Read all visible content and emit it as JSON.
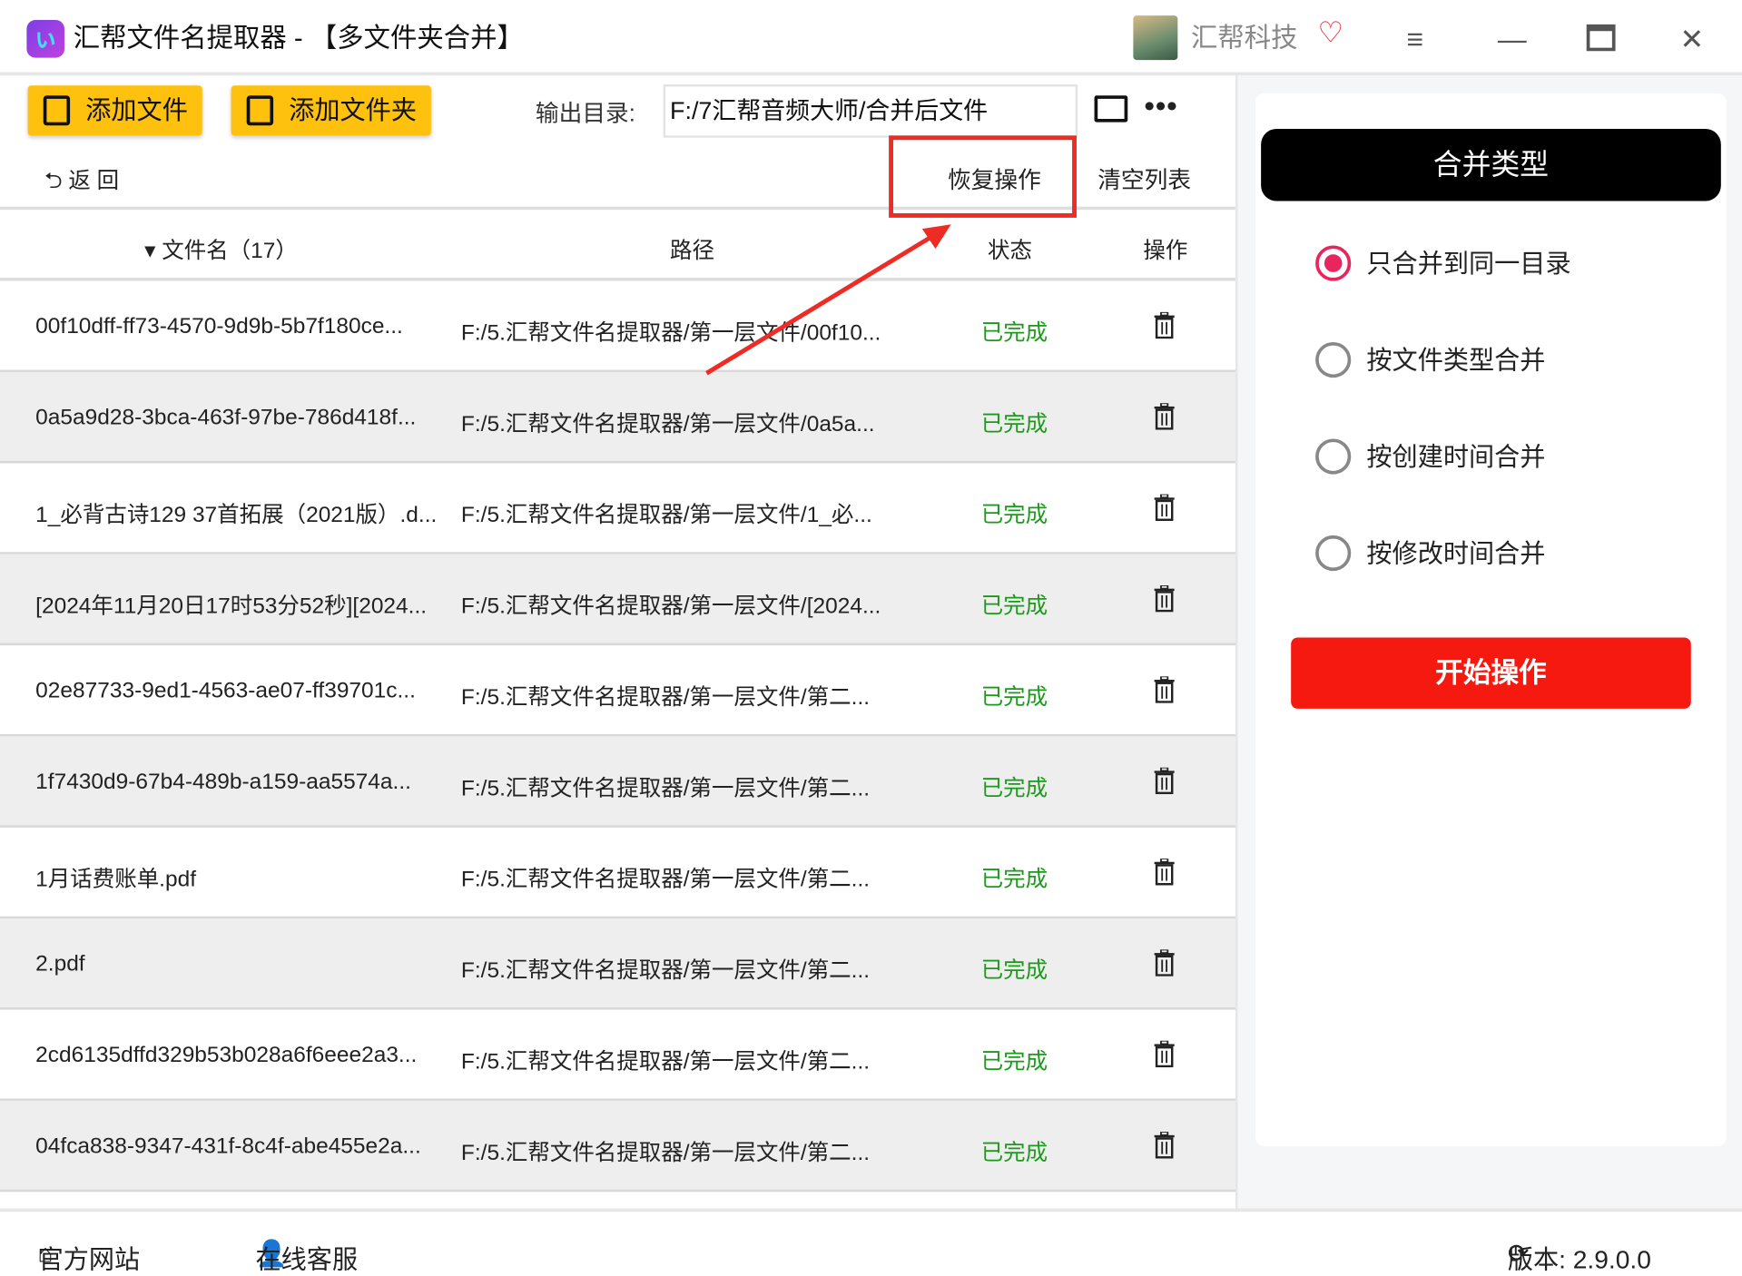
{
  "app": {
    "title": "汇帮文件名提取器 - 【多文件夹合并】",
    "brand": "汇帮科技"
  },
  "toolbar": {
    "add_file": "添加文件",
    "add_folder": "添加文件夹",
    "output_label": "输出目录:",
    "output_value": "F:/7汇帮音频大师/合并后文件",
    "more": "•••",
    "back": "返  回",
    "restore": "恢复操作",
    "clear": "清空列表"
  },
  "table": {
    "headers": {
      "name": "文件名（17）",
      "path": "路径",
      "status": "状态",
      "action": "操作"
    },
    "rows": [
      {
        "name": "00f10dff-ff73-4570-9d9b-5b7f180ce...",
        "path": "F:/5.汇帮文件名提取器/第一层文件/00f10...",
        "status": "已完成"
      },
      {
        "name": "0a5a9d28-3bca-463f-97be-786d418f...",
        "path": "F:/5.汇帮文件名提取器/第一层文件/0a5a...",
        "status": "已完成"
      },
      {
        "name": "1_必背古诗129 37首拓展（2021版）.d...",
        "path": "F:/5.汇帮文件名提取器/第一层文件/1_必...",
        "status": "已完成"
      },
      {
        "name": "[2024年11月20日17时53分52秒][2024...",
        "path": "F:/5.汇帮文件名提取器/第一层文件/[2024...",
        "status": "已完成"
      },
      {
        "name": "02e87733-9ed1-4563-ae07-ff39701c...",
        "path": "F:/5.汇帮文件名提取器/第一层文件/第二...",
        "status": "已完成"
      },
      {
        "name": "1f7430d9-67b4-489b-a159-aa5574a...",
        "path": "F:/5.汇帮文件名提取器/第一层文件/第二...",
        "status": "已完成"
      },
      {
        "name": "1月话费账单.pdf",
        "path": "F:/5.汇帮文件名提取器/第一层文件/第二...",
        "status": "已完成"
      },
      {
        "name": "2.pdf",
        "path": "F:/5.汇帮文件名提取器/第一层文件/第二...",
        "status": "已完成"
      },
      {
        "name": "2cd6135dffd329b53b028a6f6eee2a3...",
        "path": "F:/5.汇帮文件名提取器/第一层文件/第二...",
        "status": "已完成"
      },
      {
        "name": "04fca838-9347-431f-8c4f-abe455e2a...",
        "path": "F:/5.汇帮文件名提取器/第一层文件/第二...",
        "status": "已完成"
      }
    ]
  },
  "merge": {
    "title": "合并类型",
    "options": [
      {
        "label": "只合并到同一目录",
        "selected": true
      },
      {
        "label": "按文件类型合并",
        "selected": false
      },
      {
        "label": "按创建时间合并",
        "selected": false
      },
      {
        "label": "按修改时间合并",
        "selected": false
      }
    ],
    "start": "开始操作"
  },
  "footer": {
    "website": "官方网站",
    "support": "在线客服",
    "version": "版本:  2.9.0.0"
  },
  "colors": {
    "accent_yellow": "#fec10e",
    "start_red": "#f5190f",
    "radio_pink": "#e8255c",
    "status_green": "#1a9b1a",
    "annotation_red": "#ee2b25"
  }
}
